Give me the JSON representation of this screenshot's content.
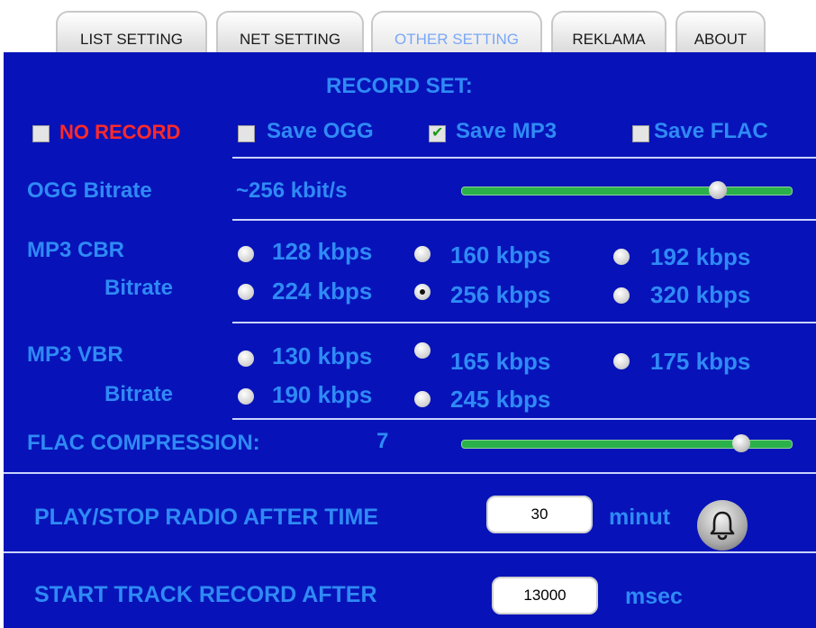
{
  "tabs": [
    "LIST SETTING",
    "NET SETTING",
    "OTHER SETTING",
    "REKLAMA",
    "ABOUT"
  ],
  "active_tab": "OTHER SETTING",
  "record_set": {
    "title": "RECORD SET:",
    "options": [
      {
        "label": "NO RECORD",
        "checked": false
      },
      {
        "label": "Save OGG",
        "checked": false
      },
      {
        "label": "Save MP3",
        "checked": true
      },
      {
        "label": "Save FLAC",
        "checked": false
      }
    ]
  },
  "ogg": {
    "label": "OGG Bitrate",
    "value": "~256 kbit/s",
    "slider_level": 0.78
  },
  "mp3_cbr": {
    "label_line1": "MP3 CBR",
    "label_line2": "Bitrate",
    "options": [
      "128 kbps",
      "160 kbps",
      "192 kbps",
      "224 kbps",
      "256 kbps",
      "320 kbps"
    ],
    "selected": "256 kbps"
  },
  "mp3_vbr": {
    "label_line1": "MP3 VBR",
    "label_line2": "Bitrate",
    "options": [
      "130 kbps",
      "165 kbps",
      "175 kbps",
      "190 kbps",
      "245 kbps"
    ],
    "selected": ""
  },
  "flac": {
    "label": "FLAC COMPRESSION:",
    "value": "7",
    "slider_level": 0.85
  },
  "timer": {
    "label": "PLAY/STOP RADIO AFTER TIME",
    "value": "30",
    "unit": "minut",
    "icon": "bell-icon"
  },
  "track": {
    "label": "START TRACK RECORD AFTER",
    "value": "13000",
    "unit": "msec"
  },
  "colors": {
    "panel": "#0713b8",
    "label": "#2f8af5",
    "no_record": "#ff2a2a"
  }
}
